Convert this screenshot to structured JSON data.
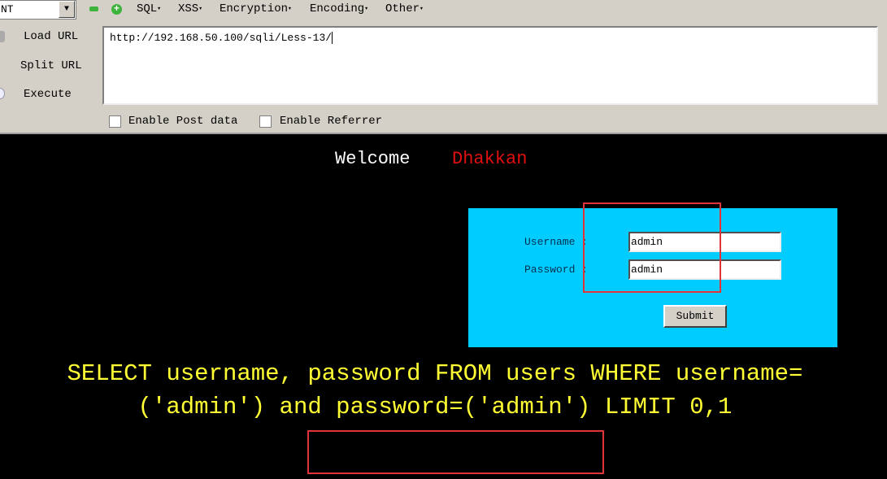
{
  "toolbar": {
    "combo_value": "NT",
    "menus": [
      "SQL",
      "XSS",
      "Encryption",
      "Encoding",
      "Other"
    ],
    "load_url": "Load URL",
    "split_url": "Split URL",
    "execute": "Execute",
    "url": "http://192.168.50.100/sqli/Less-13/",
    "enable_post": "Enable Post data",
    "enable_referrer": "Enable Referrer"
  },
  "page": {
    "welcome": "Welcome",
    "name": "Dhakkan",
    "username_label": "Username :",
    "password_label": "Password :",
    "username_value": "admin",
    "password_value": "admin",
    "submit": "Submit",
    "query_line1": "SELECT username, password FROM users WHERE username=",
    "query_line2": "('admin') and password=('admin') LIMIT 0,1"
  },
  "colors": {
    "form_bg": "#00ccff",
    "query": "#ffff33",
    "highlight": "#e0343a",
    "name": "#e01010"
  }
}
